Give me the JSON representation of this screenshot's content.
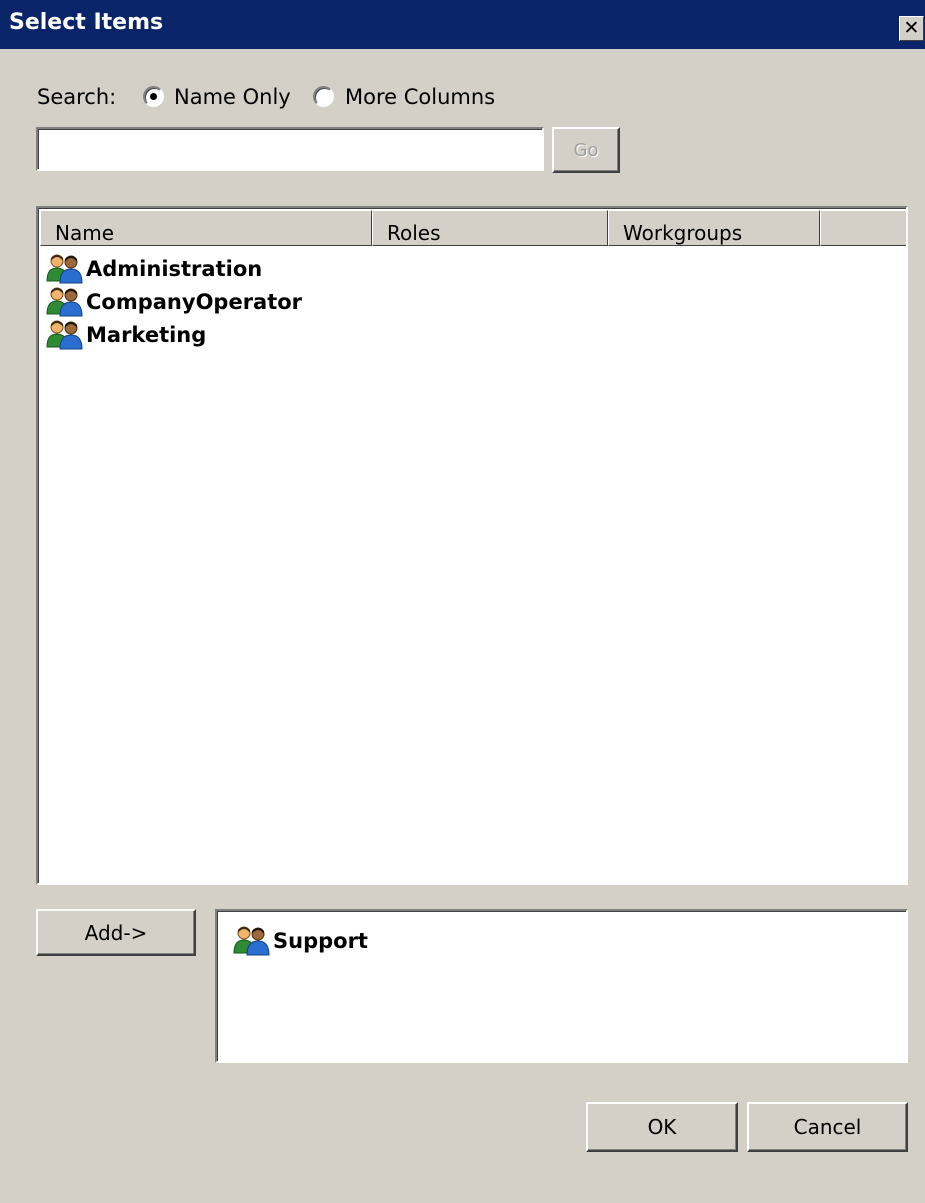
{
  "window": {
    "title": "Select Items",
    "close_icon": "close-icon"
  },
  "search": {
    "label": "Search:",
    "options": [
      {
        "label": "Name Only",
        "selected": true
      },
      {
        "label": "More Columns",
        "selected": false
      }
    ],
    "query_value": "",
    "go_label": "Go"
  },
  "list": {
    "columns": [
      "Name",
      "Roles",
      "Workgroups",
      ""
    ],
    "items": [
      {
        "name": "Administration",
        "icon": "group-icon"
      },
      {
        "name": "CompanyOperator",
        "icon": "group-icon"
      },
      {
        "name": "Marketing",
        "icon": "group-icon"
      }
    ]
  },
  "add_label": "Add->",
  "selected": {
    "items": [
      {
        "name": "Support",
        "icon": "group-icon"
      }
    ]
  },
  "footer": {
    "ok_label": "OK",
    "cancel_label": "Cancel"
  },
  "colors": {
    "titlebar": "#0a246a",
    "face": "#d4d0c8",
    "window": "#ffffff"
  }
}
